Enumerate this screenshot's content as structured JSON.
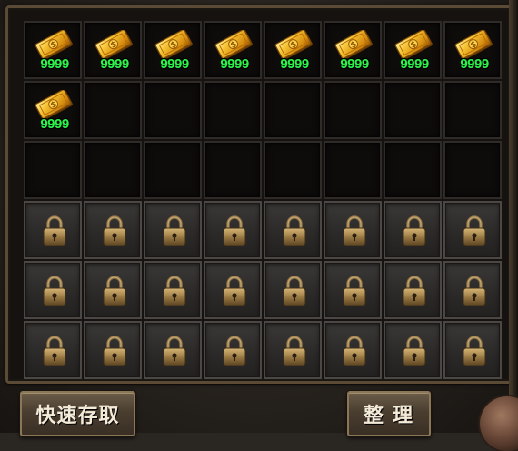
{
  "colors": {
    "quantity": "#2cf24a",
    "frame": "#5a4a36",
    "button_text": "#f3ead8"
  },
  "inventory": {
    "columns": 8,
    "rows": 6,
    "item_icon": "gold-ticket-icon",
    "lock_icon": "padlock-icon",
    "slots": [
      {
        "type": "item",
        "qty": "9999"
      },
      {
        "type": "item",
        "qty": "9999"
      },
      {
        "type": "item",
        "qty": "9999"
      },
      {
        "type": "item",
        "qty": "9999"
      },
      {
        "type": "item",
        "qty": "9999"
      },
      {
        "type": "item",
        "qty": "9999"
      },
      {
        "type": "item",
        "qty": "9999"
      },
      {
        "type": "item",
        "qty": "9999"
      },
      {
        "type": "item",
        "qty": "9999"
      },
      {
        "type": "empty"
      },
      {
        "type": "empty"
      },
      {
        "type": "empty"
      },
      {
        "type": "empty"
      },
      {
        "type": "empty"
      },
      {
        "type": "empty"
      },
      {
        "type": "empty"
      },
      {
        "type": "empty"
      },
      {
        "type": "empty"
      },
      {
        "type": "empty"
      },
      {
        "type": "empty"
      },
      {
        "type": "empty"
      },
      {
        "type": "empty"
      },
      {
        "type": "empty"
      },
      {
        "type": "empty"
      },
      {
        "type": "locked"
      },
      {
        "type": "locked"
      },
      {
        "type": "locked"
      },
      {
        "type": "locked"
      },
      {
        "type": "locked"
      },
      {
        "type": "locked"
      },
      {
        "type": "locked"
      },
      {
        "type": "locked"
      },
      {
        "type": "locked"
      },
      {
        "type": "locked"
      },
      {
        "type": "locked"
      },
      {
        "type": "locked"
      },
      {
        "type": "locked"
      },
      {
        "type": "locked"
      },
      {
        "type": "locked"
      },
      {
        "type": "locked"
      },
      {
        "type": "locked"
      },
      {
        "type": "locked"
      },
      {
        "type": "locked"
      },
      {
        "type": "locked"
      },
      {
        "type": "locked"
      },
      {
        "type": "locked"
      },
      {
        "type": "locked"
      },
      {
        "type": "locked"
      }
    ]
  },
  "buttons": {
    "quick_store": "快速存取",
    "sort": "整理"
  }
}
